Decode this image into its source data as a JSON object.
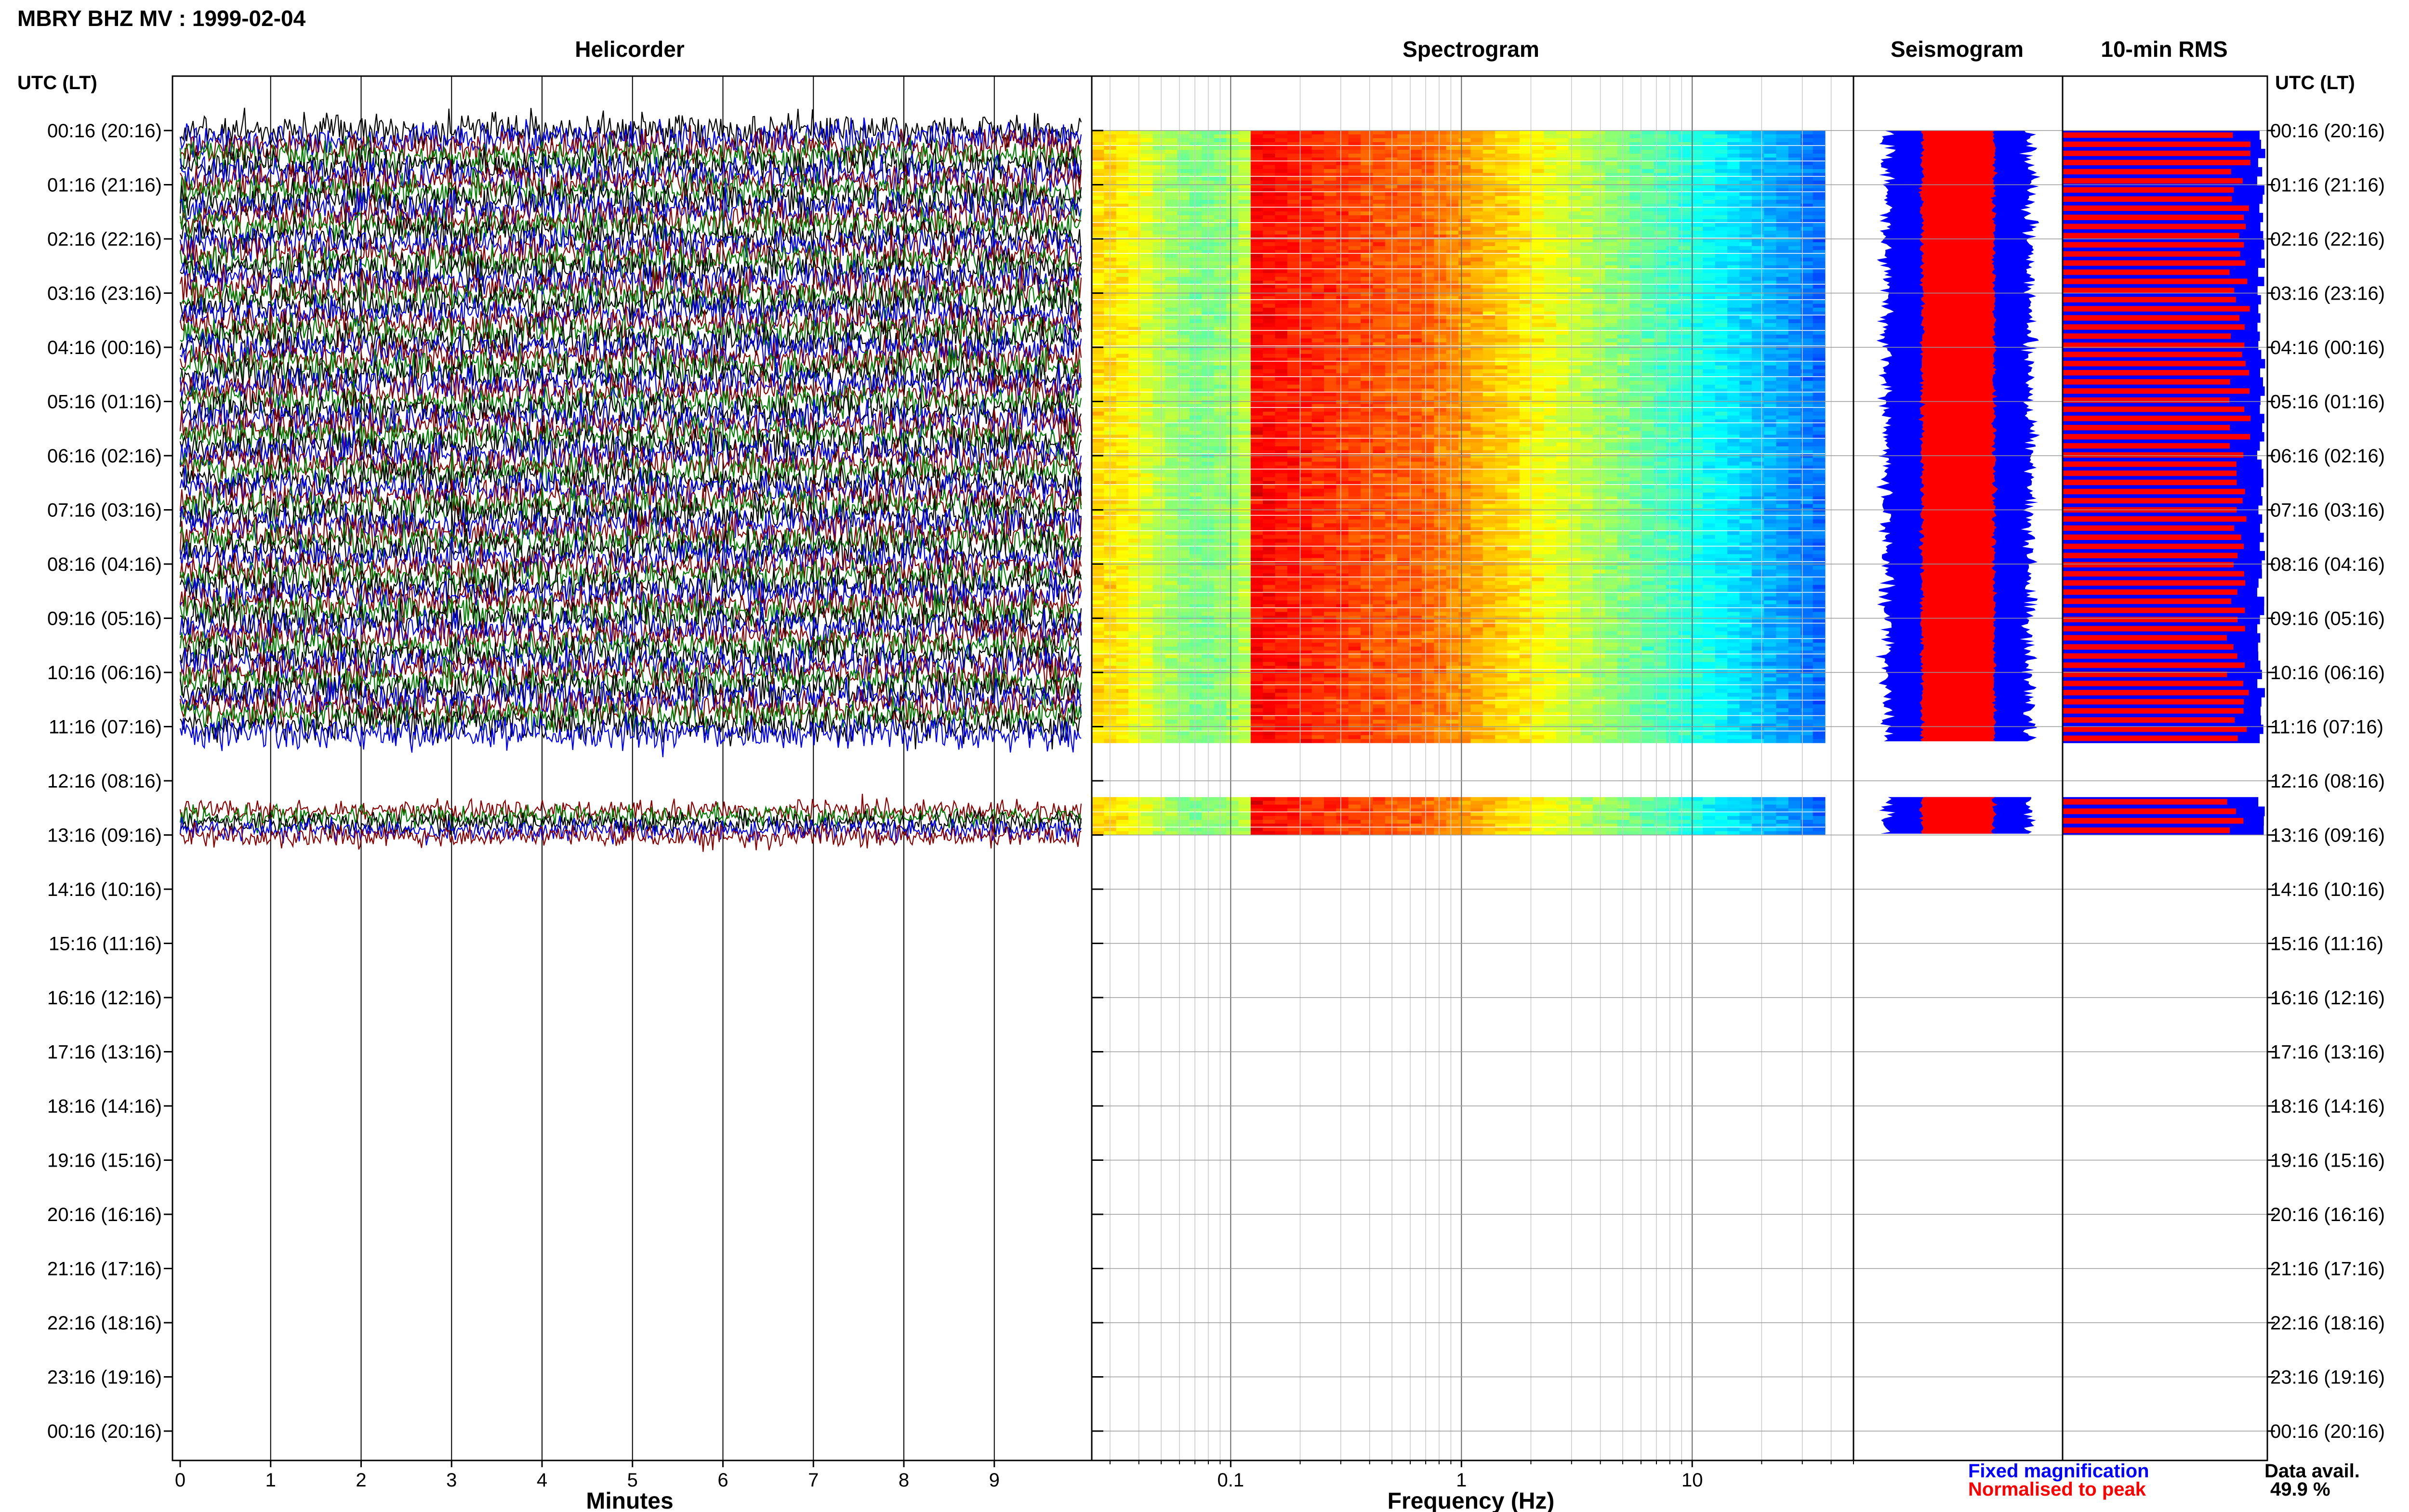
{
  "title": "MBRY BHZ MV : 1999-02-04",
  "panels": {
    "helicorder": "Helicorder",
    "spectrogram": "Spectrogram",
    "seismogram": "Seismogram",
    "rms": "10-min RMS"
  },
  "axis": {
    "row_header_left": "UTC (LT)",
    "row_header_right": "UTC (LT)",
    "minutes_label": "Minutes",
    "frequency_label": "Frequency (Hz)"
  },
  "legend": {
    "fixed": "Fixed magnification",
    "normalised": "Normalised to peak",
    "fixed_color": "#0000ff",
    "normalised_color": "#ff0000"
  },
  "data_avail": {
    "label": "Data avail.",
    "value": "49.9 %"
  },
  "colors": {
    "trace_black": "#000000",
    "trace_blue": "#0000ff",
    "trace_red": "#8b0000",
    "trace_green": "#008000",
    "rms_fill": "#0000ff",
    "rms_bar": "#ff0000"
  },
  "chart_data": {
    "type": "heatmap",
    "rows": [
      "00:16 (20:16)",
      "01:16 (21:16)",
      "02:16 (22:16)",
      "03:16 (23:16)",
      "04:16 (00:16)",
      "05:16 (01:16)",
      "06:16 (02:16)",
      "07:16 (03:16)",
      "08:16 (04:16)",
      "09:16 (05:16)",
      "10:16 (06:16)",
      "11:16 (07:16)",
      "12:16 (08:16)",
      "13:16 (09:16)",
      "14:16 (10:16)",
      "15:16 (11:16)",
      "16:16 (12:16)",
      "17:16 (13:16)",
      "18:16 (14:16)",
      "19:16 (15:16)",
      "20:16 (16:16)",
      "21:16 (17:16)",
      "22:16 (18:16)",
      "23:16 (19:16)",
      "00:16 (20:16)"
    ],
    "minutes_ticks": [
      "0",
      "1",
      "2",
      "3",
      "4",
      "5",
      "6",
      "7",
      "8",
      "9"
    ],
    "minutes_range": [
      0,
      10
    ],
    "frequency_ticks": [
      "0.1",
      "1",
      "10"
    ],
    "frequency_range_hz": [
      0.025,
      50
    ],
    "frequency_scale": "log",
    "data_segments_hours": [
      [
        0,
        11.3
      ],
      [
        12.3,
        13.0
      ]
    ],
    "spectrogram_peak_band_hz": [
      0.12,
      0.6
    ],
    "data_availability_percent": 49.9
  }
}
